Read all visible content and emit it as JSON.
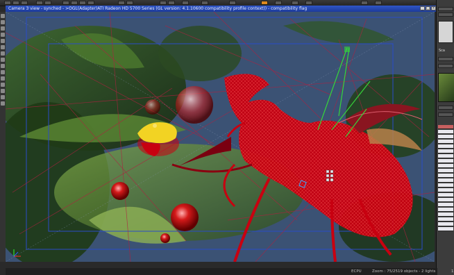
{
  "window": {
    "title": "Camera 3 view - synched - >OGL(Adapter)ATI Radeon HD 5700 Series (GL version: 4.1.10600 compatibility profile context)) - compatibility flag"
  },
  "right_panel": {
    "label_small": "Sca"
  },
  "status": {
    "mode": "ECPU",
    "zoom": "Zoom : 75/25",
    "objects": "19 objects - 2 lights",
    "frame": "175"
  },
  "colors": {
    "title_bar": "#2f55c8",
    "scene_bg": "#3b5274",
    "beetle": "#d00010",
    "accent": "#e08a1e",
    "light_beam": "#36d63a"
  },
  "icons": [
    "camera-icon",
    "move-icon",
    "rotate-icon",
    "scale-icon",
    "render-icon",
    "close-icon",
    "minimize-icon",
    "maximize-icon"
  ]
}
